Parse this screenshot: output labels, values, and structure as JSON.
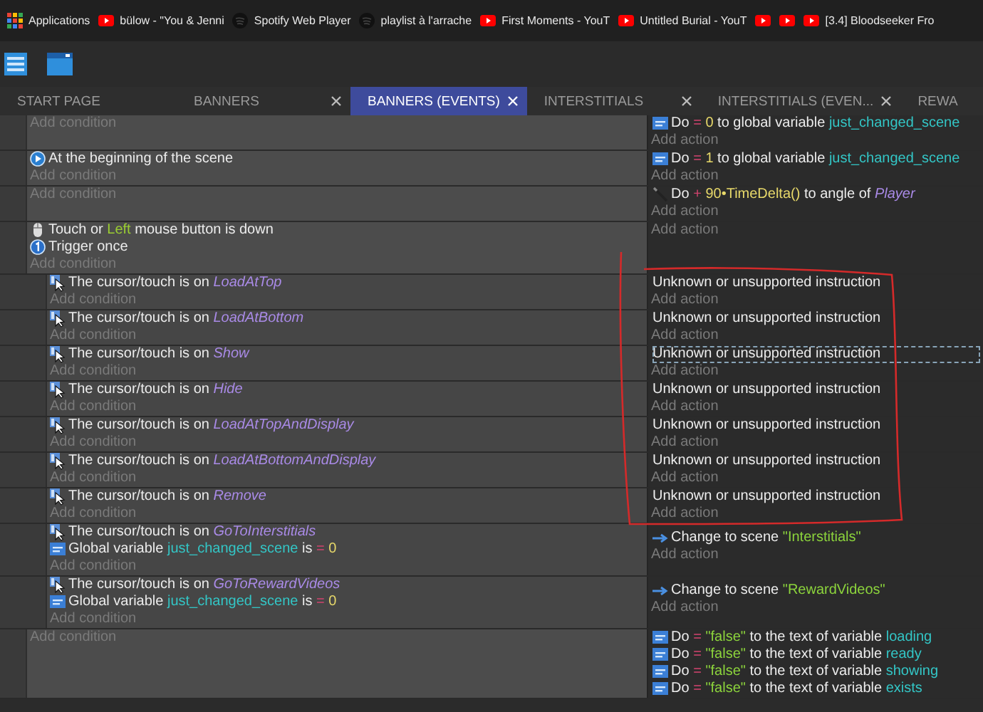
{
  "bookmarks": [
    {
      "kind": "apps",
      "label": "Applications"
    },
    {
      "kind": "youtube",
      "label": "bülow - \"You & Jenni"
    },
    {
      "kind": "spotify",
      "label": "Spotify Web Player"
    },
    {
      "kind": "spotify",
      "label": "playlist à l'arrache"
    },
    {
      "kind": "youtube",
      "label": "First Moments - YouT"
    },
    {
      "kind": "youtube",
      "label": "Untitled Burial - YouT"
    },
    {
      "kind": "youtube"
    },
    {
      "kind": "youtube"
    },
    {
      "kind": "youtube",
      "label": "[3.4] Bloodseeker Fro"
    }
  ],
  "tabs": [
    {
      "label": "START PAGE",
      "selected": false,
      "closable": false
    },
    {
      "label": "BANNERS",
      "selected": false,
      "closable": true
    },
    {
      "label": "BANNERS (EVENTS)",
      "selected": true,
      "closable": true
    },
    {
      "label": "INTERSTITIALS",
      "selected": false,
      "closable": true
    },
    {
      "label": "INTERSTITIALS (EVEN...",
      "selected": false,
      "closable": true
    },
    {
      "label": "REWA",
      "selected": false,
      "closable": false
    }
  ],
  "events": [
    {
      "add_condition": "Add condition",
      "actions": [
        {
          "kind": "variable",
          "selected": false,
          "parts": [
            {
              "kind": "plain",
              "text": "Do"
            },
            {
              "kind": "operator",
              "text": "="
            },
            {
              "kind": "number",
              "text": "0"
            },
            {
              "kind": "plain",
              "text": "to global variable"
            },
            {
              "kind": "variable",
              "text": "just_changed_scene"
            }
          ]
        }
      ],
      "add_action": "Add action"
    },
    {
      "conditions": [
        {
          "kind": "scene-start",
          "parts": [
            {
              "kind": "plain",
              "text": "At the beginning of the scene"
            }
          ]
        }
      ],
      "add_condition": "Add condition",
      "actions": [
        {
          "kind": "variable",
          "selected": false,
          "parts": [
            {
              "kind": "plain",
              "text": "Do"
            },
            {
              "kind": "operator",
              "text": "="
            },
            {
              "kind": "number",
              "text": "1"
            },
            {
              "kind": "plain",
              "text": "to global variable"
            },
            {
              "kind": "variable",
              "text": "just_changed_scene"
            }
          ]
        }
      ],
      "add_action": "Add action"
    },
    {
      "add_condition": "Add condition",
      "actions": [
        {
          "kind": "angle",
          "selected": false,
          "parts": [
            {
              "kind": "plain",
              "text": "Do"
            },
            {
              "kind": "operator",
              "text": "+"
            },
            {
              "kind": "number",
              "text": "90•TimeDelta()"
            },
            {
              "kind": "plain",
              "text": "to angle of"
            },
            {
              "kind": "object",
              "text": "Player"
            }
          ]
        }
      ],
      "add_action": "Add action"
    },
    {
      "conditions": [
        {
          "kind": "mouse",
          "parts": [
            {
              "kind": "plain",
              "text": "Touch or"
            },
            {
              "kind": "highlight",
              "text": "Left"
            },
            {
              "kind": "plain",
              "text": "mouse button is down"
            }
          ]
        },
        {
          "kind": "trigger-once",
          "parts": [
            {
              "kind": "plain",
              "text": "Trigger once"
            }
          ]
        }
      ],
      "add_condition": "Add condition",
      "add_action": "Add action",
      "children": [
        {
          "conditions": [
            {
              "kind": "cursor",
              "parts": [
                {
                  "kind": "plain",
                  "text": "The cursor/touch is on"
                },
                {
                  "kind": "object",
                  "text": "LoadAtTop"
                }
              ]
            }
          ],
          "add_condition": "Add condition",
          "actions": [
            {
              "kind": "unknown",
              "selected": false,
              "parts": [
                {
                  "kind": "plain",
                  "text": "Unknown or unsupported instruction"
                }
              ]
            }
          ],
          "add_action": "Add action"
        },
        {
          "conditions": [
            {
              "kind": "cursor",
              "parts": [
                {
                  "kind": "plain",
                  "text": "The cursor/touch is on"
                },
                {
                  "kind": "object",
                  "text": "LoadAtBottom"
                }
              ]
            }
          ],
          "add_condition": "Add condition",
          "actions": [
            {
              "kind": "unknown",
              "selected": false,
              "parts": [
                {
                  "kind": "plain",
                  "text": "Unknown or unsupported instruction"
                }
              ]
            }
          ],
          "add_action": "Add action"
        },
        {
          "conditions": [
            {
              "kind": "cursor",
              "parts": [
                {
                  "kind": "plain",
                  "text": "The cursor/touch is on"
                },
                {
                  "kind": "object",
                  "text": "Show"
                }
              ]
            }
          ],
          "add_condition": "Add condition",
          "actions": [
            {
              "kind": "unknown",
              "selected": true,
              "parts": [
                {
                  "kind": "plain",
                  "text": "Unknown or unsupported instruction"
                }
              ]
            }
          ],
          "add_action": "Add action"
        },
        {
          "conditions": [
            {
              "kind": "cursor",
              "parts": [
                {
                  "kind": "plain",
                  "text": "The cursor/touch is on"
                },
                {
                  "kind": "object",
                  "text": "Hide"
                }
              ]
            }
          ],
          "add_condition": "Add condition",
          "actions": [
            {
              "kind": "unknown",
              "selected": false,
              "parts": [
                {
                  "kind": "plain",
                  "text": "Unknown or unsupported instruction"
                }
              ]
            }
          ],
          "add_action": "Add action"
        },
        {
          "conditions": [
            {
              "kind": "cursor",
              "parts": [
                {
                  "kind": "plain",
                  "text": "The cursor/touch is on"
                },
                {
                  "kind": "object",
                  "text": "LoadAtTopAndDisplay"
                }
              ]
            }
          ],
          "add_condition": "Add condition",
          "actions": [
            {
              "kind": "unknown",
              "selected": false,
              "parts": [
                {
                  "kind": "plain",
                  "text": "Unknown or unsupported instruction"
                }
              ]
            }
          ],
          "add_action": "Add action"
        },
        {
          "conditions": [
            {
              "kind": "cursor",
              "parts": [
                {
                  "kind": "plain",
                  "text": "The cursor/touch is on"
                },
                {
                  "kind": "object",
                  "text": "LoadAtBottomAndDisplay"
                }
              ]
            }
          ],
          "add_condition": "Add condition",
          "actions": [
            {
              "kind": "unknown",
              "selected": false,
              "parts": [
                {
                  "kind": "plain",
                  "text": "Unknown or unsupported instruction"
                }
              ]
            }
          ],
          "add_action": "Add action"
        },
        {
          "conditions": [
            {
              "kind": "cursor",
              "parts": [
                {
                  "kind": "plain",
                  "text": "The cursor/touch is on"
                },
                {
                  "kind": "object",
                  "text": "Remove"
                }
              ]
            }
          ],
          "add_condition": "Add condition",
          "actions": [
            {
              "kind": "unknown",
              "selected": false,
              "parts": [
                {
                  "kind": "plain",
                  "text": "Unknown or unsupported instruction"
                }
              ]
            }
          ],
          "add_action": "Add action"
        },
        {
          "conditions": [
            {
              "kind": "cursor",
              "parts": [
                {
                  "kind": "plain",
                  "text": "The cursor/touch is on"
                },
                {
                  "kind": "object",
                  "text": "GoToInterstitials"
                }
              ]
            },
            {
              "kind": "variable",
              "parts": [
                {
                  "kind": "plain",
                  "text": "Global variable"
                },
                {
                  "kind": "variable",
                  "text": "just_changed_scene"
                },
                {
                  "kind": "plain",
                  "text": "is"
                },
                {
                  "kind": "operator",
                  "text": "="
                },
                {
                  "kind": "number",
                  "text": "0"
                }
              ]
            }
          ],
          "add_condition": "Add condition",
          "actions": [
            {
              "kind": "scene-change",
              "selected": false,
              "parts": [
                {
                  "kind": "plain",
                  "text": "Change to scene"
                },
                {
                  "kind": "string",
                  "text": "\"Interstitials\""
                }
              ]
            }
          ],
          "add_action": "Add action"
        },
        {
          "conditions": [
            {
              "kind": "cursor",
              "parts": [
                {
                  "kind": "plain",
                  "text": "The cursor/touch is on"
                },
                {
                  "kind": "object",
                  "text": "GoToRewardVideos"
                }
              ]
            },
            {
              "kind": "variable",
              "parts": [
                {
                  "kind": "plain",
                  "text": "Global variable"
                },
                {
                  "kind": "variable",
                  "text": "just_changed_scene"
                },
                {
                  "kind": "plain",
                  "text": "is"
                },
                {
                  "kind": "operator",
                  "text": "="
                },
                {
                  "kind": "number",
                  "text": "0"
                }
              ]
            }
          ],
          "add_condition": "Add condition",
          "actions": [
            {
              "kind": "scene-change",
              "selected": false,
              "parts": [
                {
                  "kind": "plain",
                  "text": "Change to scene"
                },
                {
                  "kind": "string",
                  "text": "\"RewardVideos\""
                }
              ]
            }
          ],
          "add_action": "Add action"
        }
      ]
    },
    {
      "add_condition": "Add condition",
      "actions": [
        {
          "kind": "variable",
          "selected": false,
          "parts": [
            {
              "kind": "plain",
              "text": "Do"
            },
            {
              "kind": "operator",
              "text": "="
            },
            {
              "kind": "string",
              "text": "\"false\""
            },
            {
              "kind": "plain",
              "text": "to the text of variable"
            },
            {
              "kind": "variable",
              "text": "loading"
            }
          ]
        },
        {
          "kind": "variable",
          "selected": false,
          "parts": [
            {
              "kind": "plain",
              "text": "Do"
            },
            {
              "kind": "operator",
              "text": "="
            },
            {
              "kind": "string",
              "text": "\"false\""
            },
            {
              "kind": "plain",
              "text": "to the text of variable"
            },
            {
              "kind": "variable",
              "text": "ready"
            }
          ]
        },
        {
          "kind": "variable",
          "selected": false,
          "parts": [
            {
              "kind": "plain",
              "text": "Do"
            },
            {
              "kind": "operator",
              "text": "="
            },
            {
              "kind": "string",
              "text": "\"false\""
            },
            {
              "kind": "plain",
              "text": "to the text of variable"
            },
            {
              "kind": "variable",
              "text": "showing"
            }
          ]
        },
        {
          "kind": "variable",
          "selected": false,
          "parts": [
            {
              "kind": "plain",
              "text": "Do"
            },
            {
              "kind": "operator",
              "text": "="
            },
            {
              "kind": "string",
              "text": "\"false\""
            },
            {
              "kind": "plain",
              "text": "to the text of variable"
            },
            {
              "kind": "variable",
              "text": "exists"
            }
          ]
        }
      ]
    }
  ]
}
